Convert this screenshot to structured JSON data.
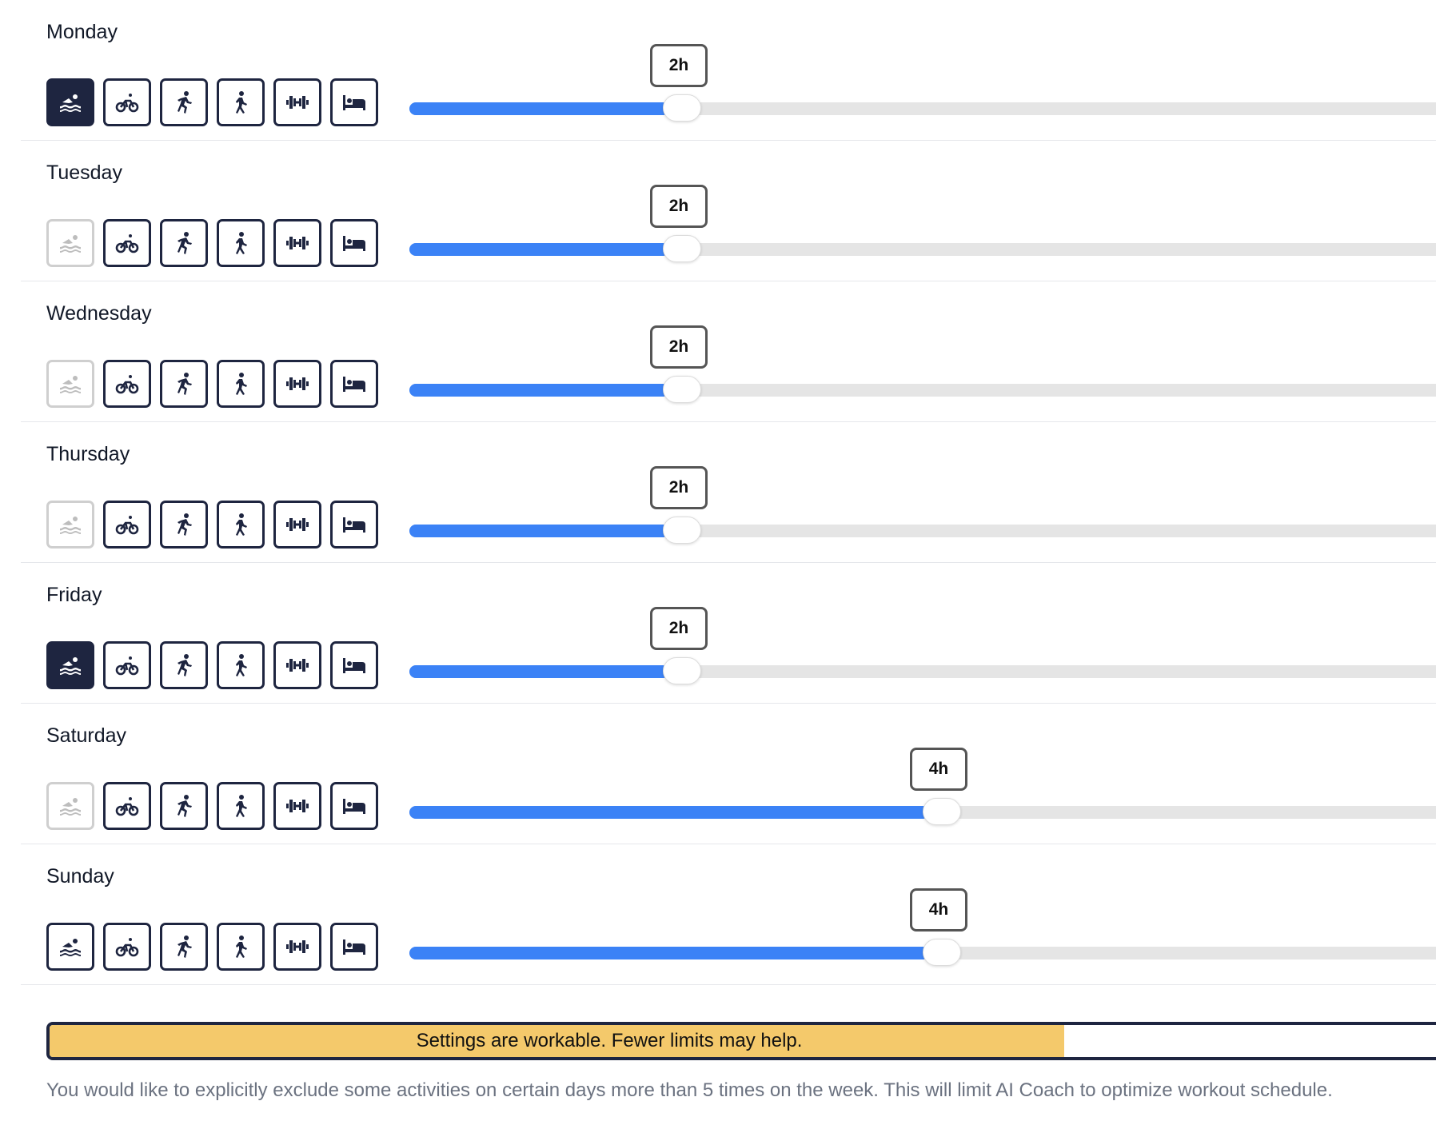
{
  "max_hours": 8,
  "days": [
    {
      "name": "Monday",
      "hours": 2,
      "label": "2h",
      "activities": [
        "selected",
        "normal",
        "normal",
        "normal",
        "normal",
        "normal"
      ]
    },
    {
      "name": "Tuesday",
      "hours": 2,
      "label": "2h",
      "activities": [
        "disabled",
        "normal",
        "normal",
        "normal",
        "normal",
        "normal"
      ]
    },
    {
      "name": "Wednesday",
      "hours": 2,
      "label": "2h",
      "activities": [
        "disabled",
        "normal",
        "normal",
        "normal",
        "normal",
        "normal"
      ]
    },
    {
      "name": "Thursday",
      "hours": 2,
      "label": "2h",
      "activities": [
        "disabled",
        "normal",
        "normal",
        "normal",
        "normal",
        "normal"
      ]
    },
    {
      "name": "Friday",
      "hours": 2,
      "label": "2h",
      "activities": [
        "selected",
        "normal",
        "normal",
        "normal",
        "normal",
        "normal"
      ]
    },
    {
      "name": "Saturday",
      "hours": 4,
      "label": "4h",
      "activities": [
        "disabled",
        "normal",
        "normal",
        "normal",
        "normal",
        "normal"
      ]
    },
    {
      "name": "Sunday",
      "hours": 4,
      "label": "4h",
      "activities": [
        "normal",
        "normal",
        "normal",
        "normal",
        "normal",
        "normal"
      ]
    }
  ],
  "activity_icons": [
    "swim-icon",
    "bike-icon",
    "run-icon",
    "walk-icon",
    "strength-icon",
    "rest-icon"
  ],
  "status": {
    "text": "Settings are workable. Fewer limits may help.",
    "level": 0.73,
    "color": "#f4c96b"
  },
  "note": "You would like to explicitly exclude some activities on certain days more than 5 times on the week. This will limit AI Coach to optimize workout schedule.",
  "colors": {
    "accent": "#3b82f6",
    "navy": "#1e2540",
    "track": "#e5e5e5"
  }
}
